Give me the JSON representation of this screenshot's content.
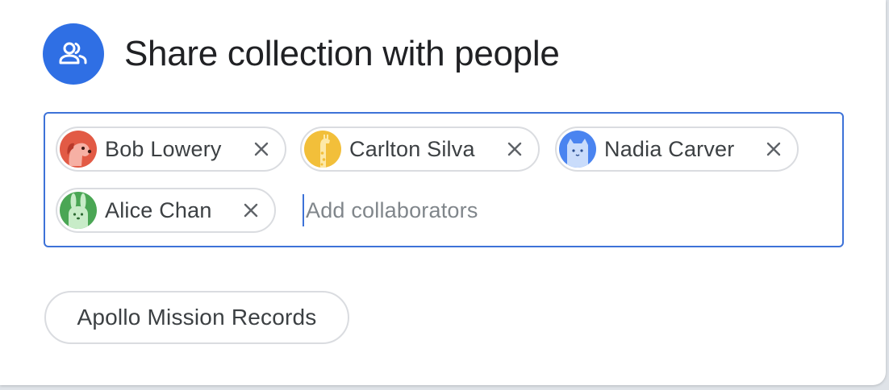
{
  "dialog": {
    "title": "Share collection with people",
    "header_icon": "people-icon",
    "accent_color": "#2f6fe4"
  },
  "collaborators": {
    "chips": [
      {
        "name": "Bob Lowery",
        "avatar": "dog-avatar",
        "avatar_color": "#e25a45"
      },
      {
        "name": "Carlton Silva",
        "avatar": "giraffe-avatar",
        "avatar_color": "#f2bf3a"
      },
      {
        "name": "Nadia Carver",
        "avatar": "cat-avatar",
        "avatar_color": "#4a84f0"
      },
      {
        "name": "Alice Chan",
        "avatar": "rabbit-avatar",
        "avatar_color": "#4aa654"
      }
    ],
    "remove_icon": "close-icon",
    "input_value": "",
    "input_placeholder": "Add collaborators"
  },
  "collection": {
    "label": "Apollo Mission Records"
  }
}
